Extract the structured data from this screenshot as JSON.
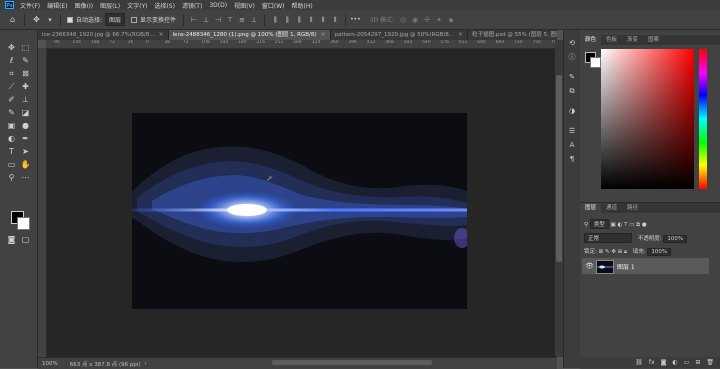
{
  "menubar": {
    "logo": "Ps",
    "items": [
      "文件(F)",
      "编辑(E)",
      "图像(I)",
      "图层(L)",
      "文字(Y)",
      "选择(S)",
      "滤镜(T)",
      "3D(D)",
      "视图(V)",
      "窗口(W)",
      "帮助(H)"
    ]
  },
  "options": {
    "home_icon": "home-icon",
    "auto_select_label": "自动选择:",
    "auto_select_value": "图层",
    "transform_label": "显示变换控件",
    "mode_3d_label": "3D 模式:",
    "more_label": "•••"
  },
  "tabs": [
    {
      "label": "ice-2366348_1920.jpg @ 66.7%(RGB/8...",
      "active": false
    },
    {
      "label": "lens-2488346_1280 (1).png @ 100% (图层 1, RGB/8)",
      "active": true
    },
    {
      "label": "pattern-2054297_1920.jpg @ 50%(RGB/8...",
      "active": false
    },
    {
      "label": "粒子插图.psd @ 55% (图层 5, 图层蒙版/...",
      "active": false
    }
  ],
  "ruler": {
    "h_ticks": [
      "90",
      "144",
      "108",
      "72",
      "36",
      "0",
      "36",
      "72",
      "108",
      "144",
      "180",
      "216",
      "252",
      "288",
      "324",
      "360",
      "396",
      "432",
      "468",
      "504",
      "540",
      "576",
      "612",
      "648",
      "684",
      "720",
      "756",
      "792"
    ]
  },
  "status": {
    "zoom": "100%",
    "doc_size": "663 点 x 387.8 点 (96 ppi)",
    "arrow": "›"
  },
  "color_panel": {
    "tabs": [
      "颜色",
      "色板",
      "渐变",
      "图案"
    ]
  },
  "layers_panel": {
    "tabs": [
      "图层",
      "通道",
      "路径"
    ],
    "filter_label": "类型",
    "blend_mode": "正常",
    "opacity_label": "不透明度:",
    "opacity_value": "100%",
    "lock_label": "锁定:",
    "fill_label": "填充:",
    "fill_value": "100%",
    "layers": [
      {
        "name": "图层 1",
        "visible": true,
        "selected": true
      }
    ]
  }
}
